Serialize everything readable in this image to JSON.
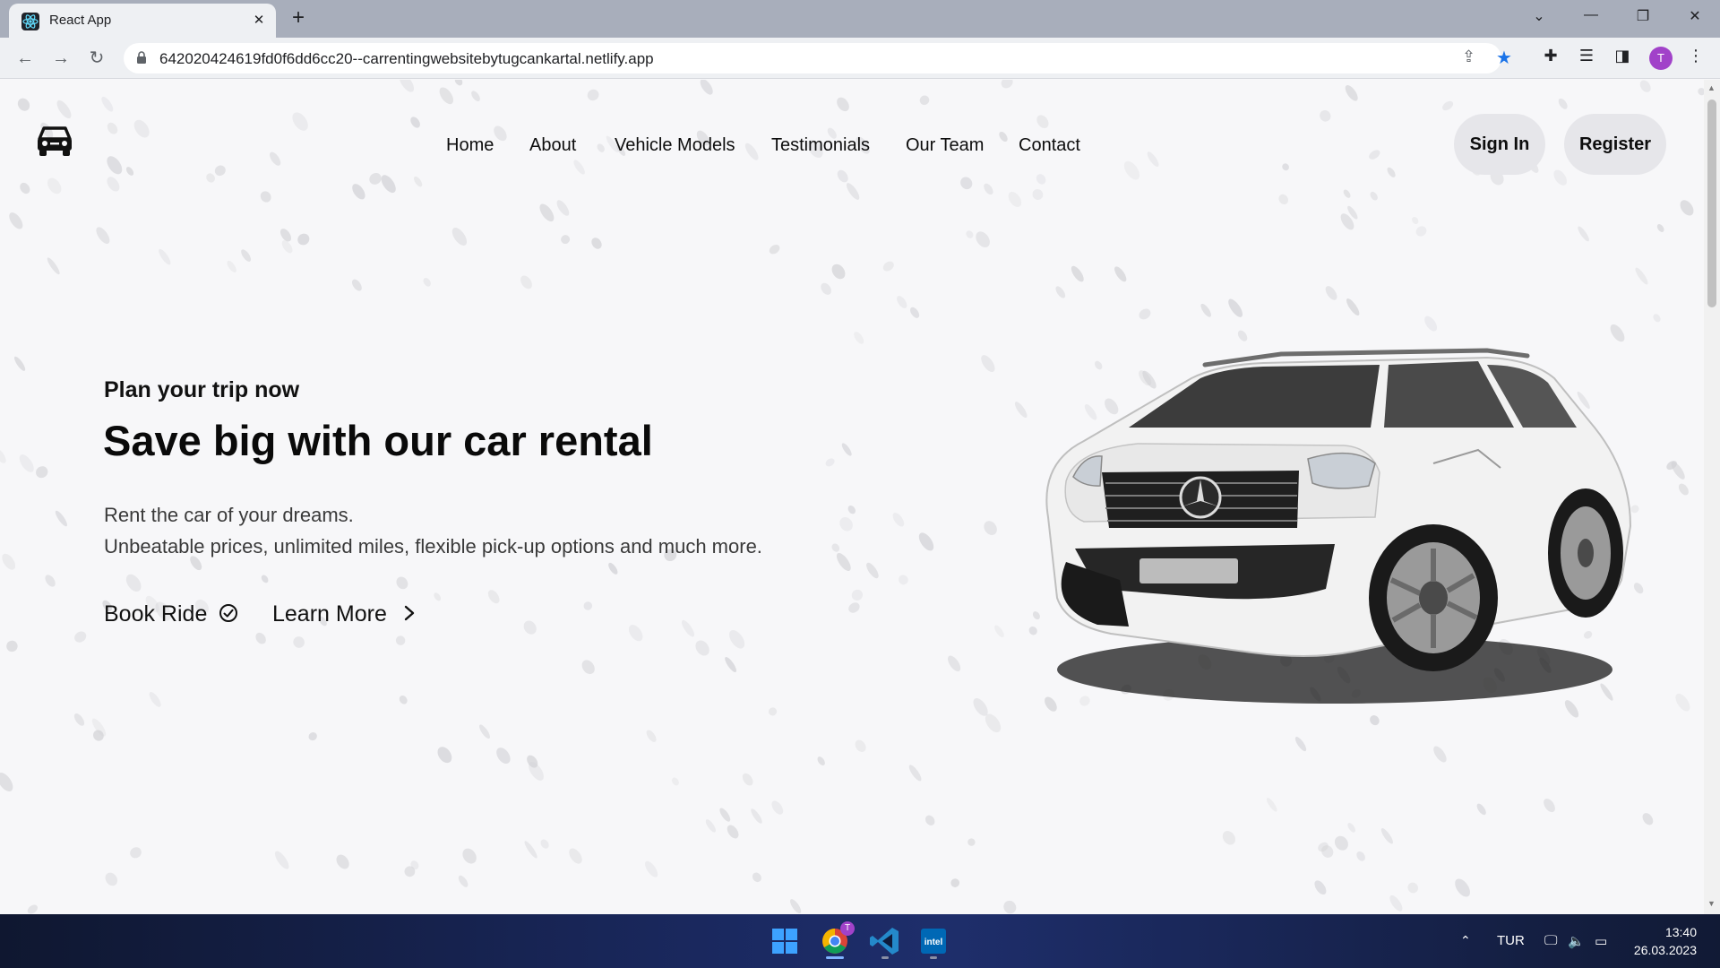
{
  "browser": {
    "tab_title": "React App",
    "url": "642020424619fd0f6dd6cc20--carrentingwebsitebytugcankartal.netlify.app",
    "profile_initial": "T"
  },
  "site": {
    "nav": [
      "Home",
      "About",
      "Vehicle Models",
      "Testimonials",
      "Our Team",
      "Contact"
    ],
    "sign_in": "Sign In",
    "register": "Register"
  },
  "hero": {
    "kicker": "Plan your trip now",
    "title": "Save big with our car rental",
    "line1": "Rent the car of your dreams.",
    "line2": "Unbeatable prices, unlimited miles, flexible pick-up options and much more.",
    "book_ride": "Book Ride",
    "learn_more": "Learn More"
  },
  "taskbar": {
    "lang": "TUR",
    "time": "13:40",
    "date": "26.03.2023",
    "chrome_badge": "T"
  },
  "colors": {
    "page_bg": "#f7f7f9",
    "button_bg": "#e6e6ea",
    "profile": "#a142c9",
    "bookmark_star": "#1a73e8"
  }
}
